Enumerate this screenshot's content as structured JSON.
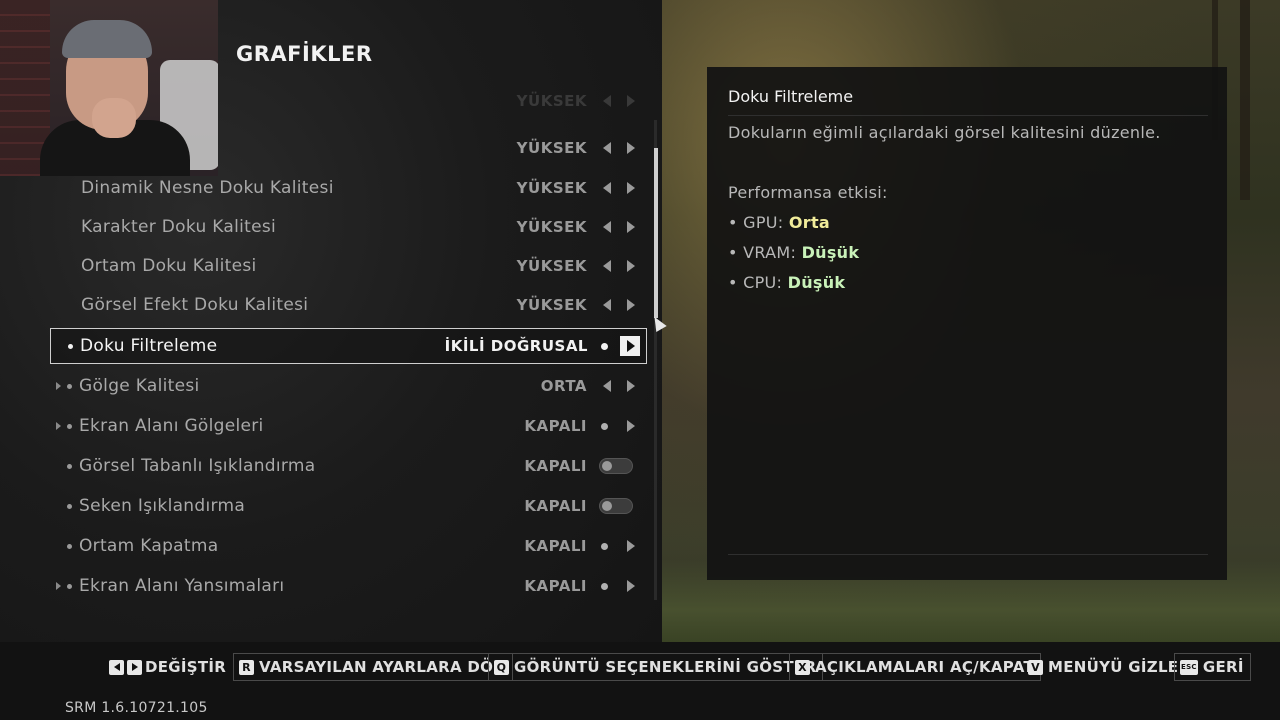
{
  "page": {
    "title": "GRAFİKLER"
  },
  "settings": {
    "faded_value": "YÜKSEK",
    "rows": [
      {
        "label": "",
        "value": "YÜKSEK"
      },
      {
        "label": "Dinamik Nesne Doku Kalitesi",
        "value": "YÜKSEK"
      },
      {
        "label": "Karakter Doku Kalitesi",
        "value": "YÜKSEK"
      },
      {
        "label": "Ortam Doku Kalitesi",
        "value": "YÜKSEK"
      },
      {
        "label": "Görsel Efekt Doku Kalitesi",
        "value": "YÜKSEK"
      },
      {
        "label": "Doku Filtreleme",
        "value": "İKİLİ DOĞRUSAL"
      },
      {
        "label": "Gölge Kalitesi",
        "value": "ORTA"
      },
      {
        "label": "Ekran Alanı Gölgeleri",
        "value": "KAPALI"
      },
      {
        "label": "Görsel Tabanlı Işıklandırma",
        "value": "KAPALI"
      },
      {
        "label": "Seken Işıklandırma",
        "value": "KAPALI"
      },
      {
        "label": "Ortam Kapatma",
        "value": "KAPALI"
      },
      {
        "label": "Ekran Alanı Yansımaları",
        "value": "KAPALI"
      }
    ]
  },
  "info": {
    "title": "Doku Filtreleme",
    "description": "Dokuların eğimli açılardaki görsel kalitesini düzenle.",
    "performance_label": "Performansa etkisi:",
    "gpu_label": "• GPU: ",
    "gpu_value": "Orta",
    "vram_label": "• VRAM: ",
    "vram_value": "Düşük",
    "cpu_label": "• CPU: ",
    "cpu_value": "Düşük"
  },
  "hints": {
    "change": "DEĞİŞTİR",
    "reset_key": "R",
    "reset": "VARSAYILAN AYARLARA DÖN",
    "display_key": "Q",
    "display": "GÖRÜNTÜ SEÇENEKLERİNİ GÖSTER",
    "desc_key": "X",
    "desc": "AÇIKLAMALARI AÇ/KAPAT",
    "hide_key": "V",
    "hide": "MENÜYÜ GİZLE",
    "back_key": "ESC",
    "back": "GERİ"
  },
  "version": "SRM 1.6.10721.105"
}
